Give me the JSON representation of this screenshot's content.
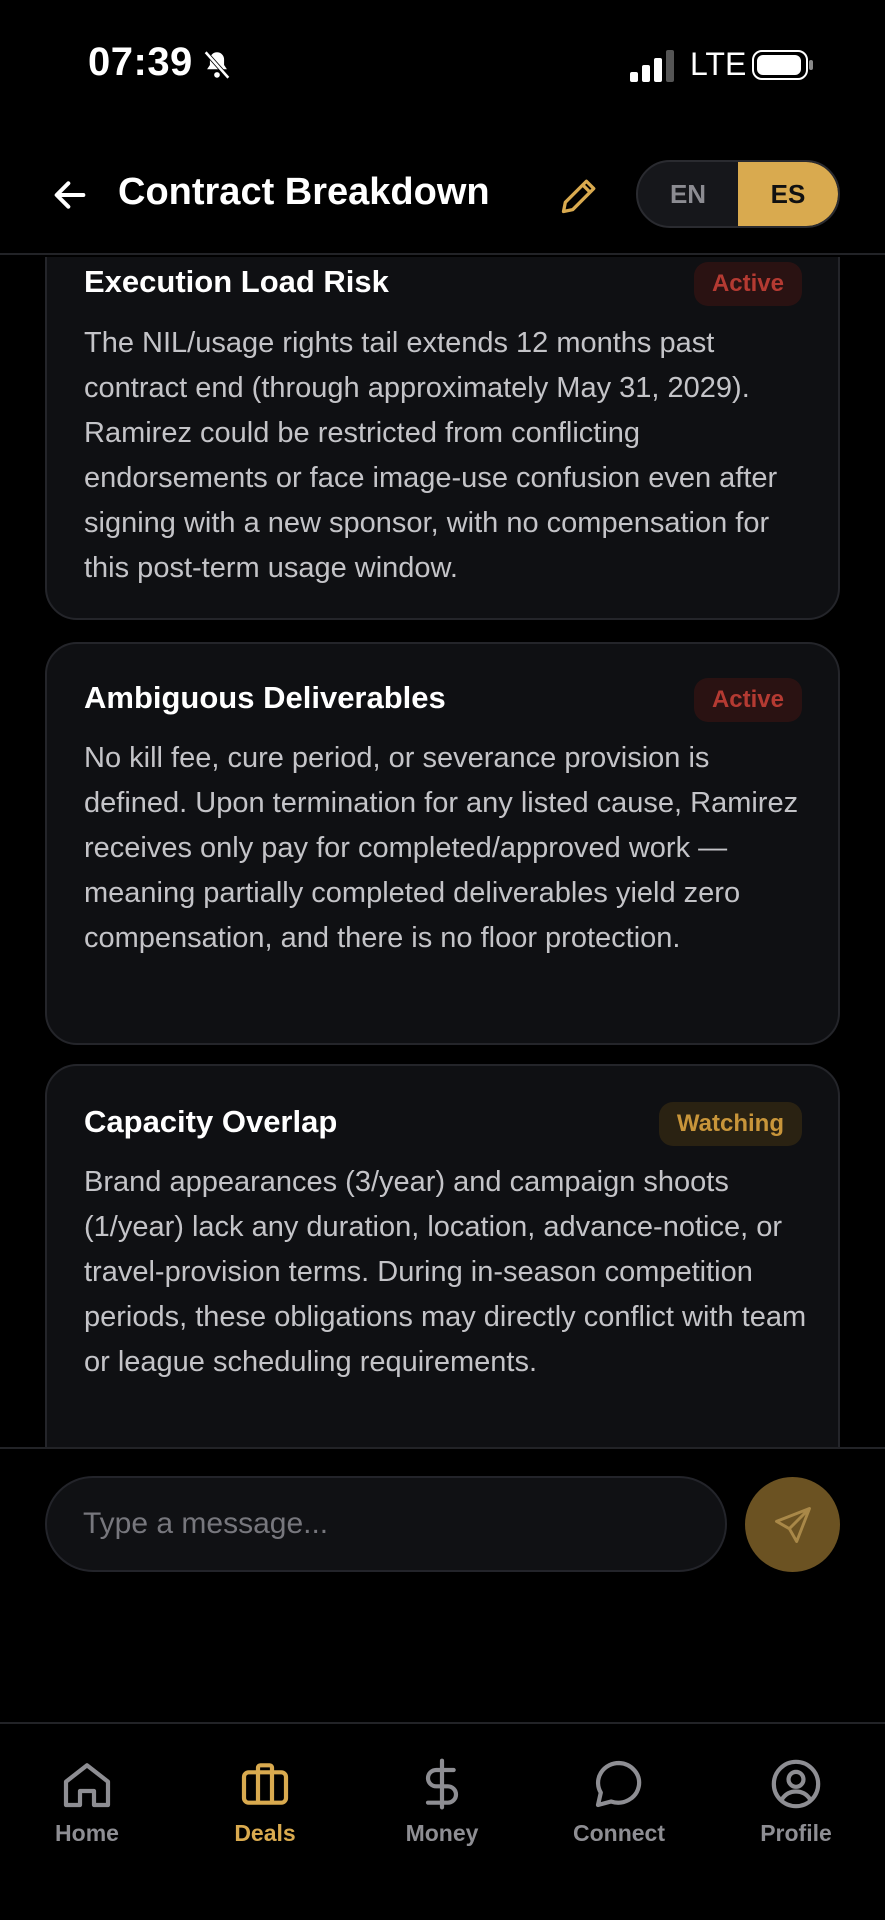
{
  "status_bar": {
    "time": "07:39",
    "network": "LTE"
  },
  "header": {
    "title": "Contract Breakdown",
    "lang_en": "EN",
    "lang_es": "ES",
    "selected_lang": "ES"
  },
  "cards": [
    {
      "title": "Execution Load Risk",
      "badge": "Active",
      "body": "The NIL/usage rights tail extends 12 months past contract end (through approximately May 31, 2029). Ramirez could be restricted from conflicting endorsements or face image-use confusion even after signing with a new sponsor, with no compensation for this post-term usage window."
    },
    {
      "title": "Ambiguous Deliverables",
      "badge": "Active",
      "body": "No kill fee, cure period, or severance provision is defined. Upon termination for any listed cause, Ramirez receives only pay for completed/approved work — meaning partially completed deliverables yield zero compensation, and there is no floor protection."
    },
    {
      "title": "Capacity Overlap",
      "badge": "Watching",
      "body": "Brand appearances (3/year) and campaign shoots (1/year) lack any duration, location, advance-notice, or travel-provision terms. During in-season competition periods, these obligations may directly conflict with team or league scheduling requirements."
    }
  ],
  "composer": {
    "placeholder": "Type a message..."
  },
  "tabs": [
    {
      "label": "Home",
      "icon": "home-icon"
    },
    {
      "label": "Deals",
      "icon": "briefcase-icon",
      "active": true
    },
    {
      "label": "Money",
      "icon": "dollar-icon"
    },
    {
      "label": "Connect",
      "icon": "chat-bubble-icon"
    },
    {
      "label": "Profile",
      "icon": "user-circle-icon"
    }
  ],
  "colors": {
    "accent": "#d9aa4f",
    "active_badge": "#b43a32",
    "watching_badge": "#c8953a",
    "background": "#000000",
    "card": "#0f1013"
  }
}
